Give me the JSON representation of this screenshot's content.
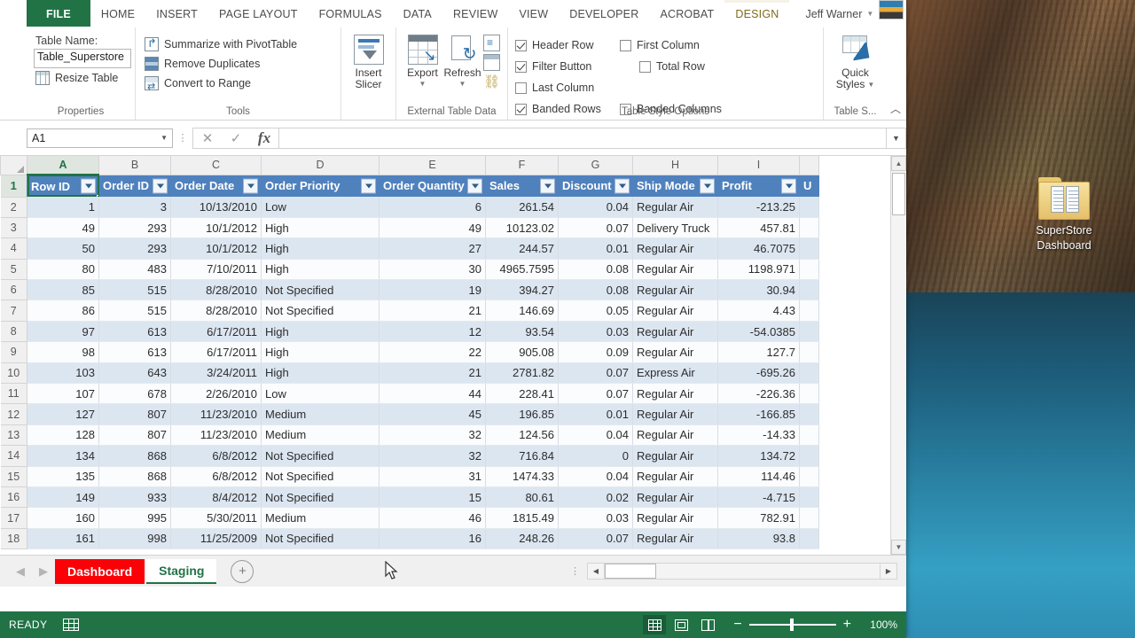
{
  "desktop": {
    "icon": {
      "label_line1": "SuperStore",
      "label_line2": "Dashboard",
      "name": "folder-icon"
    }
  },
  "window": {
    "tabs": [
      {
        "label": "FILE",
        "kind": "file"
      },
      {
        "label": "HOME",
        "kind": "normal"
      },
      {
        "label": "INSERT",
        "kind": "normal"
      },
      {
        "label": "PAGE LAYOUT",
        "kind": "normal"
      },
      {
        "label": "FORMULAS",
        "kind": "normal"
      },
      {
        "label": "DATA",
        "kind": "normal"
      },
      {
        "label": "REVIEW",
        "kind": "normal"
      },
      {
        "label": "VIEW",
        "kind": "normal"
      },
      {
        "label": "DEVELOPER",
        "kind": "normal"
      },
      {
        "label": "ACROBAT",
        "kind": "normal"
      },
      {
        "label": "DESIGN",
        "kind": "contextual"
      }
    ],
    "account_name": "Jeff Warner"
  },
  "ribbon": {
    "properties": {
      "group_label": "Properties",
      "table_name_caption": "Table Name:",
      "table_name_value": "Table_Superstore",
      "resize_table": "Resize Table"
    },
    "tools": {
      "group_label": "Tools",
      "summarize": "Summarize with PivotTable",
      "remove_duplicates": "Remove Duplicates",
      "convert_to_range": "Convert to Range"
    },
    "slicer": {
      "line1": "Insert",
      "line2": "Slicer"
    },
    "external": {
      "group_label": "External Table Data",
      "export": "Export",
      "refresh": "Refresh"
    },
    "table_style_options": {
      "group_label": "Table Style Options",
      "items": [
        {
          "label": "Header Row",
          "checked": true
        },
        {
          "label": "First Column",
          "checked": false
        },
        {
          "label": "Filter Button",
          "checked": true
        },
        {
          "label": "Total Row",
          "checked": false
        },
        {
          "label": "Last Column",
          "checked": false
        },
        {
          "label": "Banded Rows",
          "checked": true
        },
        {
          "label": "Banded Columns",
          "checked": false
        }
      ]
    },
    "quick_styles": {
      "group_label": "Table S...",
      "line1": "Quick",
      "line2": "Styles"
    },
    "collapse_icon": "chevron-up-icon"
  },
  "formula_bar": {
    "name_box_value": "A1",
    "formula_value": "",
    "cancel_icon": "close-icon",
    "confirm_icon": "check-icon",
    "function_icon": "fx"
  },
  "grid": {
    "column_letters": [
      "A",
      "B",
      "C",
      "D",
      "E",
      "F",
      "G",
      "H",
      "I"
    ],
    "selected_column": "A",
    "selected_row": "1",
    "row_numbers": [
      "1",
      "2",
      "3",
      "4",
      "5",
      "6",
      "7",
      "8",
      "9",
      "10",
      "11",
      "12",
      "13",
      "14",
      "15",
      "16",
      "17",
      "18"
    ],
    "headers": [
      "Row ID",
      "Order ID",
      "Order Date",
      "Order Priority",
      "Order Quantity",
      "Sales",
      "Discount",
      "Ship Mode",
      "Profit",
      "U"
    ],
    "rows": [
      {
        "n": "2",
        "cells": [
          "1",
          "3",
          "10/13/2010",
          "Low",
          "6",
          "261.54",
          "0.04",
          "Regular Air",
          "-213.25"
        ]
      },
      {
        "n": "3",
        "cells": [
          "49",
          "293",
          "10/1/2012",
          "High",
          "49",
          "10123.02",
          "0.07",
          "Delivery Truck",
          "457.81"
        ]
      },
      {
        "n": "4",
        "cells": [
          "50",
          "293",
          "10/1/2012",
          "High",
          "27",
          "244.57",
          "0.01",
          "Regular Air",
          "46.7075"
        ]
      },
      {
        "n": "5",
        "cells": [
          "80",
          "483",
          "7/10/2011",
          "High",
          "30",
          "4965.7595",
          "0.08",
          "Regular Air",
          "1198.971"
        ]
      },
      {
        "n": "6",
        "cells": [
          "85",
          "515",
          "8/28/2010",
          "Not Specified",
          "19",
          "394.27",
          "0.08",
          "Regular Air",
          "30.94"
        ]
      },
      {
        "n": "7",
        "cells": [
          "86",
          "515",
          "8/28/2010",
          "Not Specified",
          "21",
          "146.69",
          "0.05",
          "Regular Air",
          "4.43"
        ]
      },
      {
        "n": "8",
        "cells": [
          "97",
          "613",
          "6/17/2011",
          "High",
          "12",
          "93.54",
          "0.03",
          "Regular Air",
          "-54.0385"
        ]
      },
      {
        "n": "9",
        "cells": [
          "98",
          "613",
          "6/17/2011",
          "High",
          "22",
          "905.08",
          "0.09",
          "Regular Air",
          "127.7"
        ]
      },
      {
        "n": "10",
        "cells": [
          "103",
          "643",
          "3/24/2011",
          "High",
          "21",
          "2781.82",
          "0.07",
          "Express Air",
          "-695.26"
        ]
      },
      {
        "n": "11",
        "cells": [
          "107",
          "678",
          "2/26/2010",
          "Low",
          "44",
          "228.41",
          "0.07",
          "Regular Air",
          "-226.36"
        ]
      },
      {
        "n": "12",
        "cells": [
          "127",
          "807",
          "11/23/2010",
          "Medium",
          "45",
          "196.85",
          "0.01",
          "Regular Air",
          "-166.85"
        ]
      },
      {
        "n": "13",
        "cells": [
          "128",
          "807",
          "11/23/2010",
          "Medium",
          "32",
          "124.56",
          "0.04",
          "Regular Air",
          "-14.33"
        ]
      },
      {
        "n": "14",
        "cells": [
          "134",
          "868",
          "6/8/2012",
          "Not Specified",
          "32",
          "716.84",
          "0",
          "Regular Air",
          "134.72"
        ]
      },
      {
        "n": "15",
        "cells": [
          "135",
          "868",
          "6/8/2012",
          "Not Specified",
          "31",
          "1474.33",
          "0.04",
          "Regular Air",
          "114.46"
        ]
      },
      {
        "n": "16",
        "cells": [
          "149",
          "933",
          "8/4/2012",
          "Not Specified",
          "15",
          "80.61",
          "0.02",
          "Regular Air",
          "-4.715"
        ]
      },
      {
        "n": "17",
        "cells": [
          "160",
          "995",
          "5/30/2011",
          "Medium",
          "46",
          "1815.49",
          "0.03",
          "Regular Air",
          "782.91"
        ]
      },
      {
        "n": "18",
        "cells": [
          "161",
          "998",
          "11/25/2009",
          "Not Specified",
          "16",
          "248.26",
          "0.07",
          "Regular Air",
          "93.8"
        ]
      }
    ]
  },
  "sheet_tabs": {
    "tabs": [
      {
        "label": "Dashboard",
        "state": "inactive-red"
      },
      {
        "label": "Staging",
        "state": "active"
      }
    ],
    "add_sheet_icon": "plus-circle-icon",
    "prev_icon": "chevron-left-icon",
    "next_icon": "chevron-right-icon"
  },
  "status_bar": {
    "ready_text": "READY",
    "macro_icon": "record-macro-icon",
    "views": [
      {
        "name": "normal-view",
        "active": true
      },
      {
        "name": "page-layout-view",
        "active": false
      },
      {
        "name": "page-break-preview",
        "active": false
      }
    ],
    "zoom_out": "−",
    "zoom_in": "+",
    "zoom_level": "100%"
  },
  "colors": {
    "excel_green": "#217346",
    "table_header_blue": "#4f81bd",
    "banded_row": "#dce6f1",
    "dashboard_tab_red": "#fb0007"
  }
}
